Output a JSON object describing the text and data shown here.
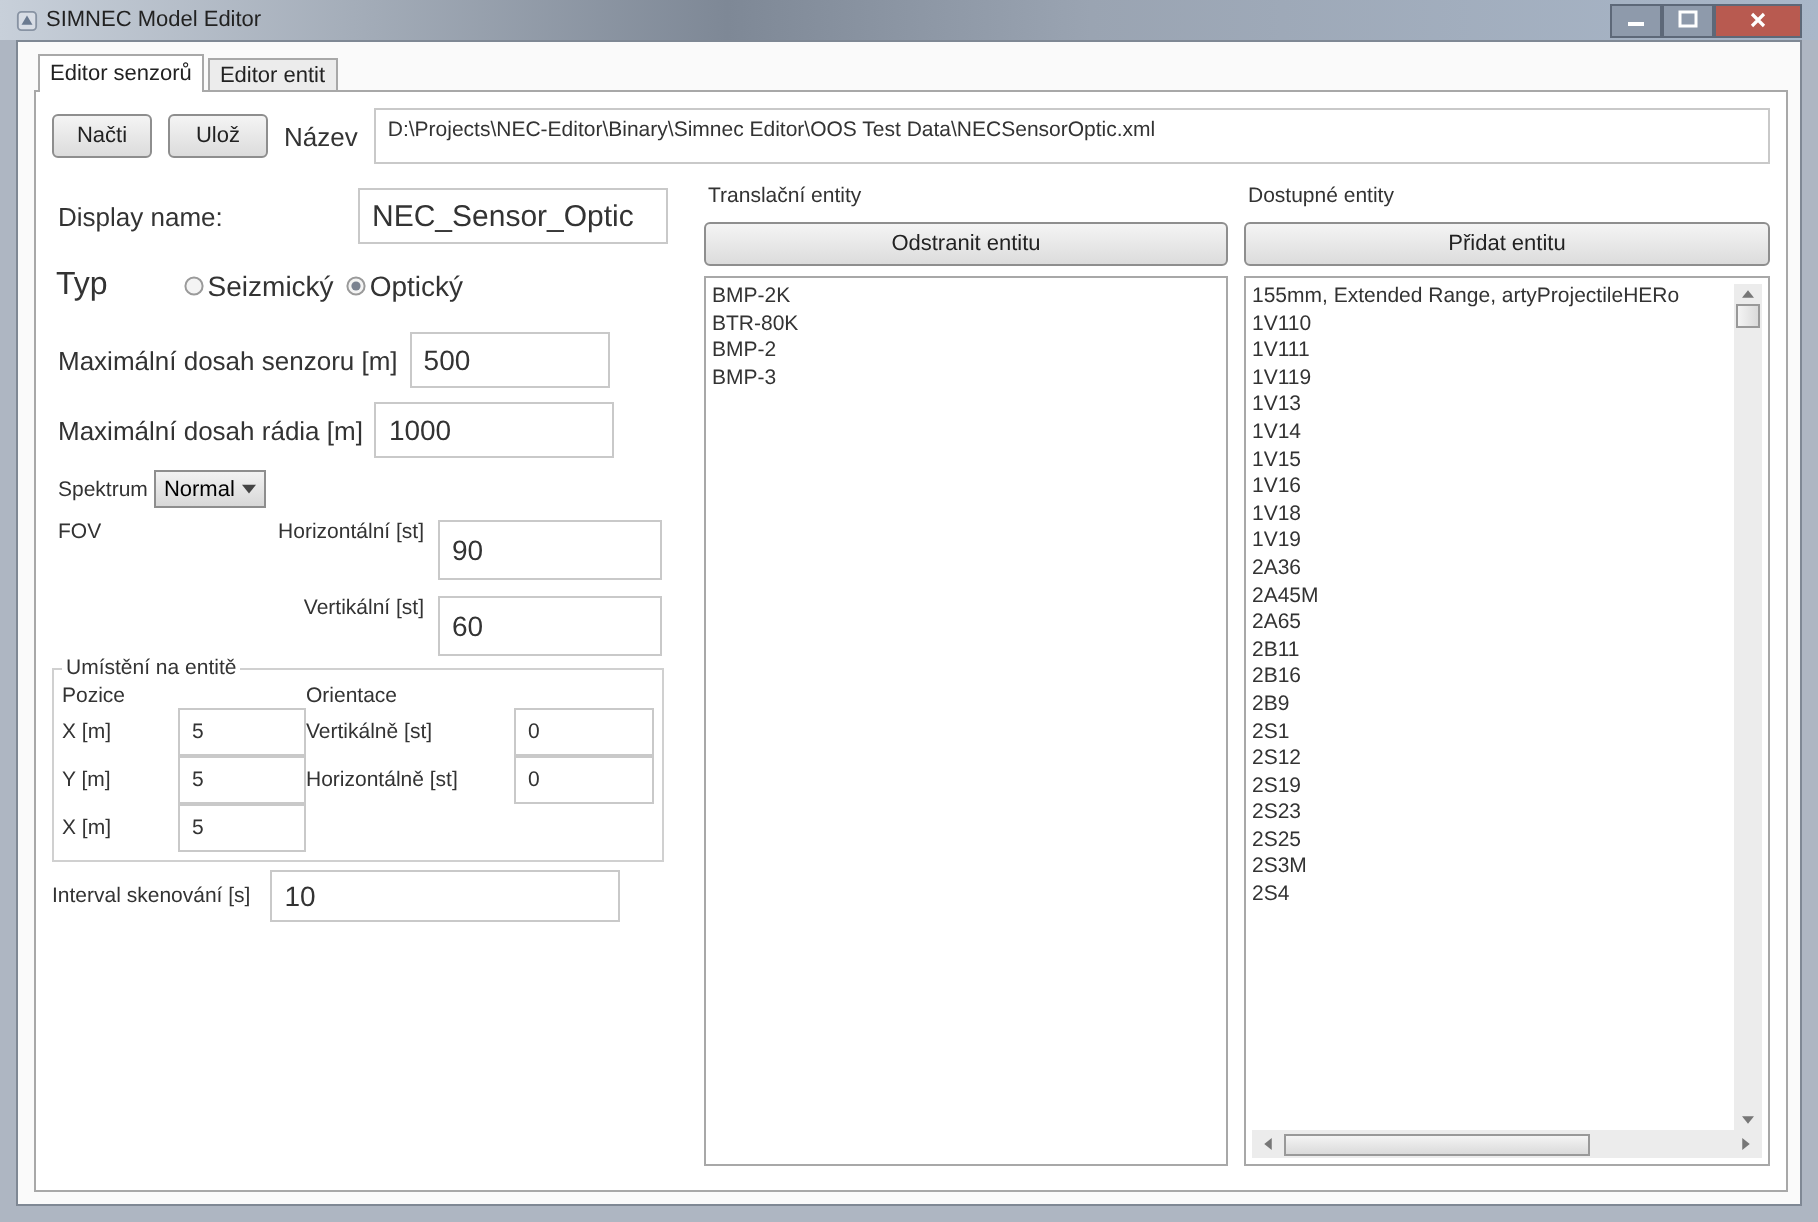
{
  "window": {
    "title": "SIMNEC Model Editor"
  },
  "tabs": [
    {
      "label": "Editor senzorů",
      "selected": true
    },
    {
      "label": "Editor entit",
      "selected": false
    }
  ],
  "toolbar": {
    "buttons": [
      "Načti",
      "Ulož"
    ],
    "file_label": "Název",
    "file_path": "D:\\Projects\\NEC-Editor\\Binary\\Simnec Editor\\OOS Test Data\\NECSensorOptic.xml"
  },
  "sensor": {
    "display_name_label": "Display name:",
    "display_name": "NEC_Sensor_Optic",
    "type_label": "Typ",
    "type_options": [
      {
        "label": "Seizmický",
        "selected": false
      },
      {
        "label": "Optický",
        "selected": true
      }
    ],
    "sensor_range_label": "Maximální dosah senzoru [m]",
    "sensor_range": "500",
    "radio_range_label": "Maximální dosah rádia [m]",
    "radio_range": "1000",
    "spectrum_label": "Spektrum",
    "spectrum": "Normal",
    "fov_label": "FOV",
    "fov_horizontal_label": "Horizontální [st]",
    "fov_horizontal": "90",
    "fov_vertical_label": "Vertikální [st]",
    "fov_vertical": "60",
    "placement": {
      "title": "Umístění na entitě",
      "position_label": "Pozice",
      "orientation_label": "Orientace",
      "position": [
        {
          "label": "X [m]",
          "value": "5"
        },
        {
          "label": "Y [m]",
          "value": "5"
        },
        {
          "label": "X [m]",
          "value": "5"
        }
      ],
      "orientation": [
        {
          "label": "Vertikálně [st]",
          "value": "0"
        },
        {
          "label": "Horizontálně [st]",
          "value": "0"
        }
      ]
    },
    "scan_interval_label": "Interval skenování [s]",
    "scan_interval": "10"
  },
  "translation_entities": {
    "title": "Translační entity",
    "button": "Odstranit entitu",
    "items": [
      "BMP-2K",
      "BTR-80K",
      "BMP-2",
      "BMP-3"
    ]
  },
  "available_entities": {
    "title": "Dostupné entity",
    "button": "Přidat entitu",
    "items": [
      "155mm, Extended Range, artyProjectileHERo",
      "1V110",
      "1V111",
      "1V119",
      "1V13",
      "1V14",
      "1V15",
      "1V16",
      "1V18",
      "1V19",
      "2A36",
      "2A45M",
      "2A65",
      "2B11",
      "2B16",
      "2B9",
      "2S1",
      "2S12",
      "2S19",
      "2S23",
      "2S25",
      "2S3M",
      "2S4"
    ]
  }
}
